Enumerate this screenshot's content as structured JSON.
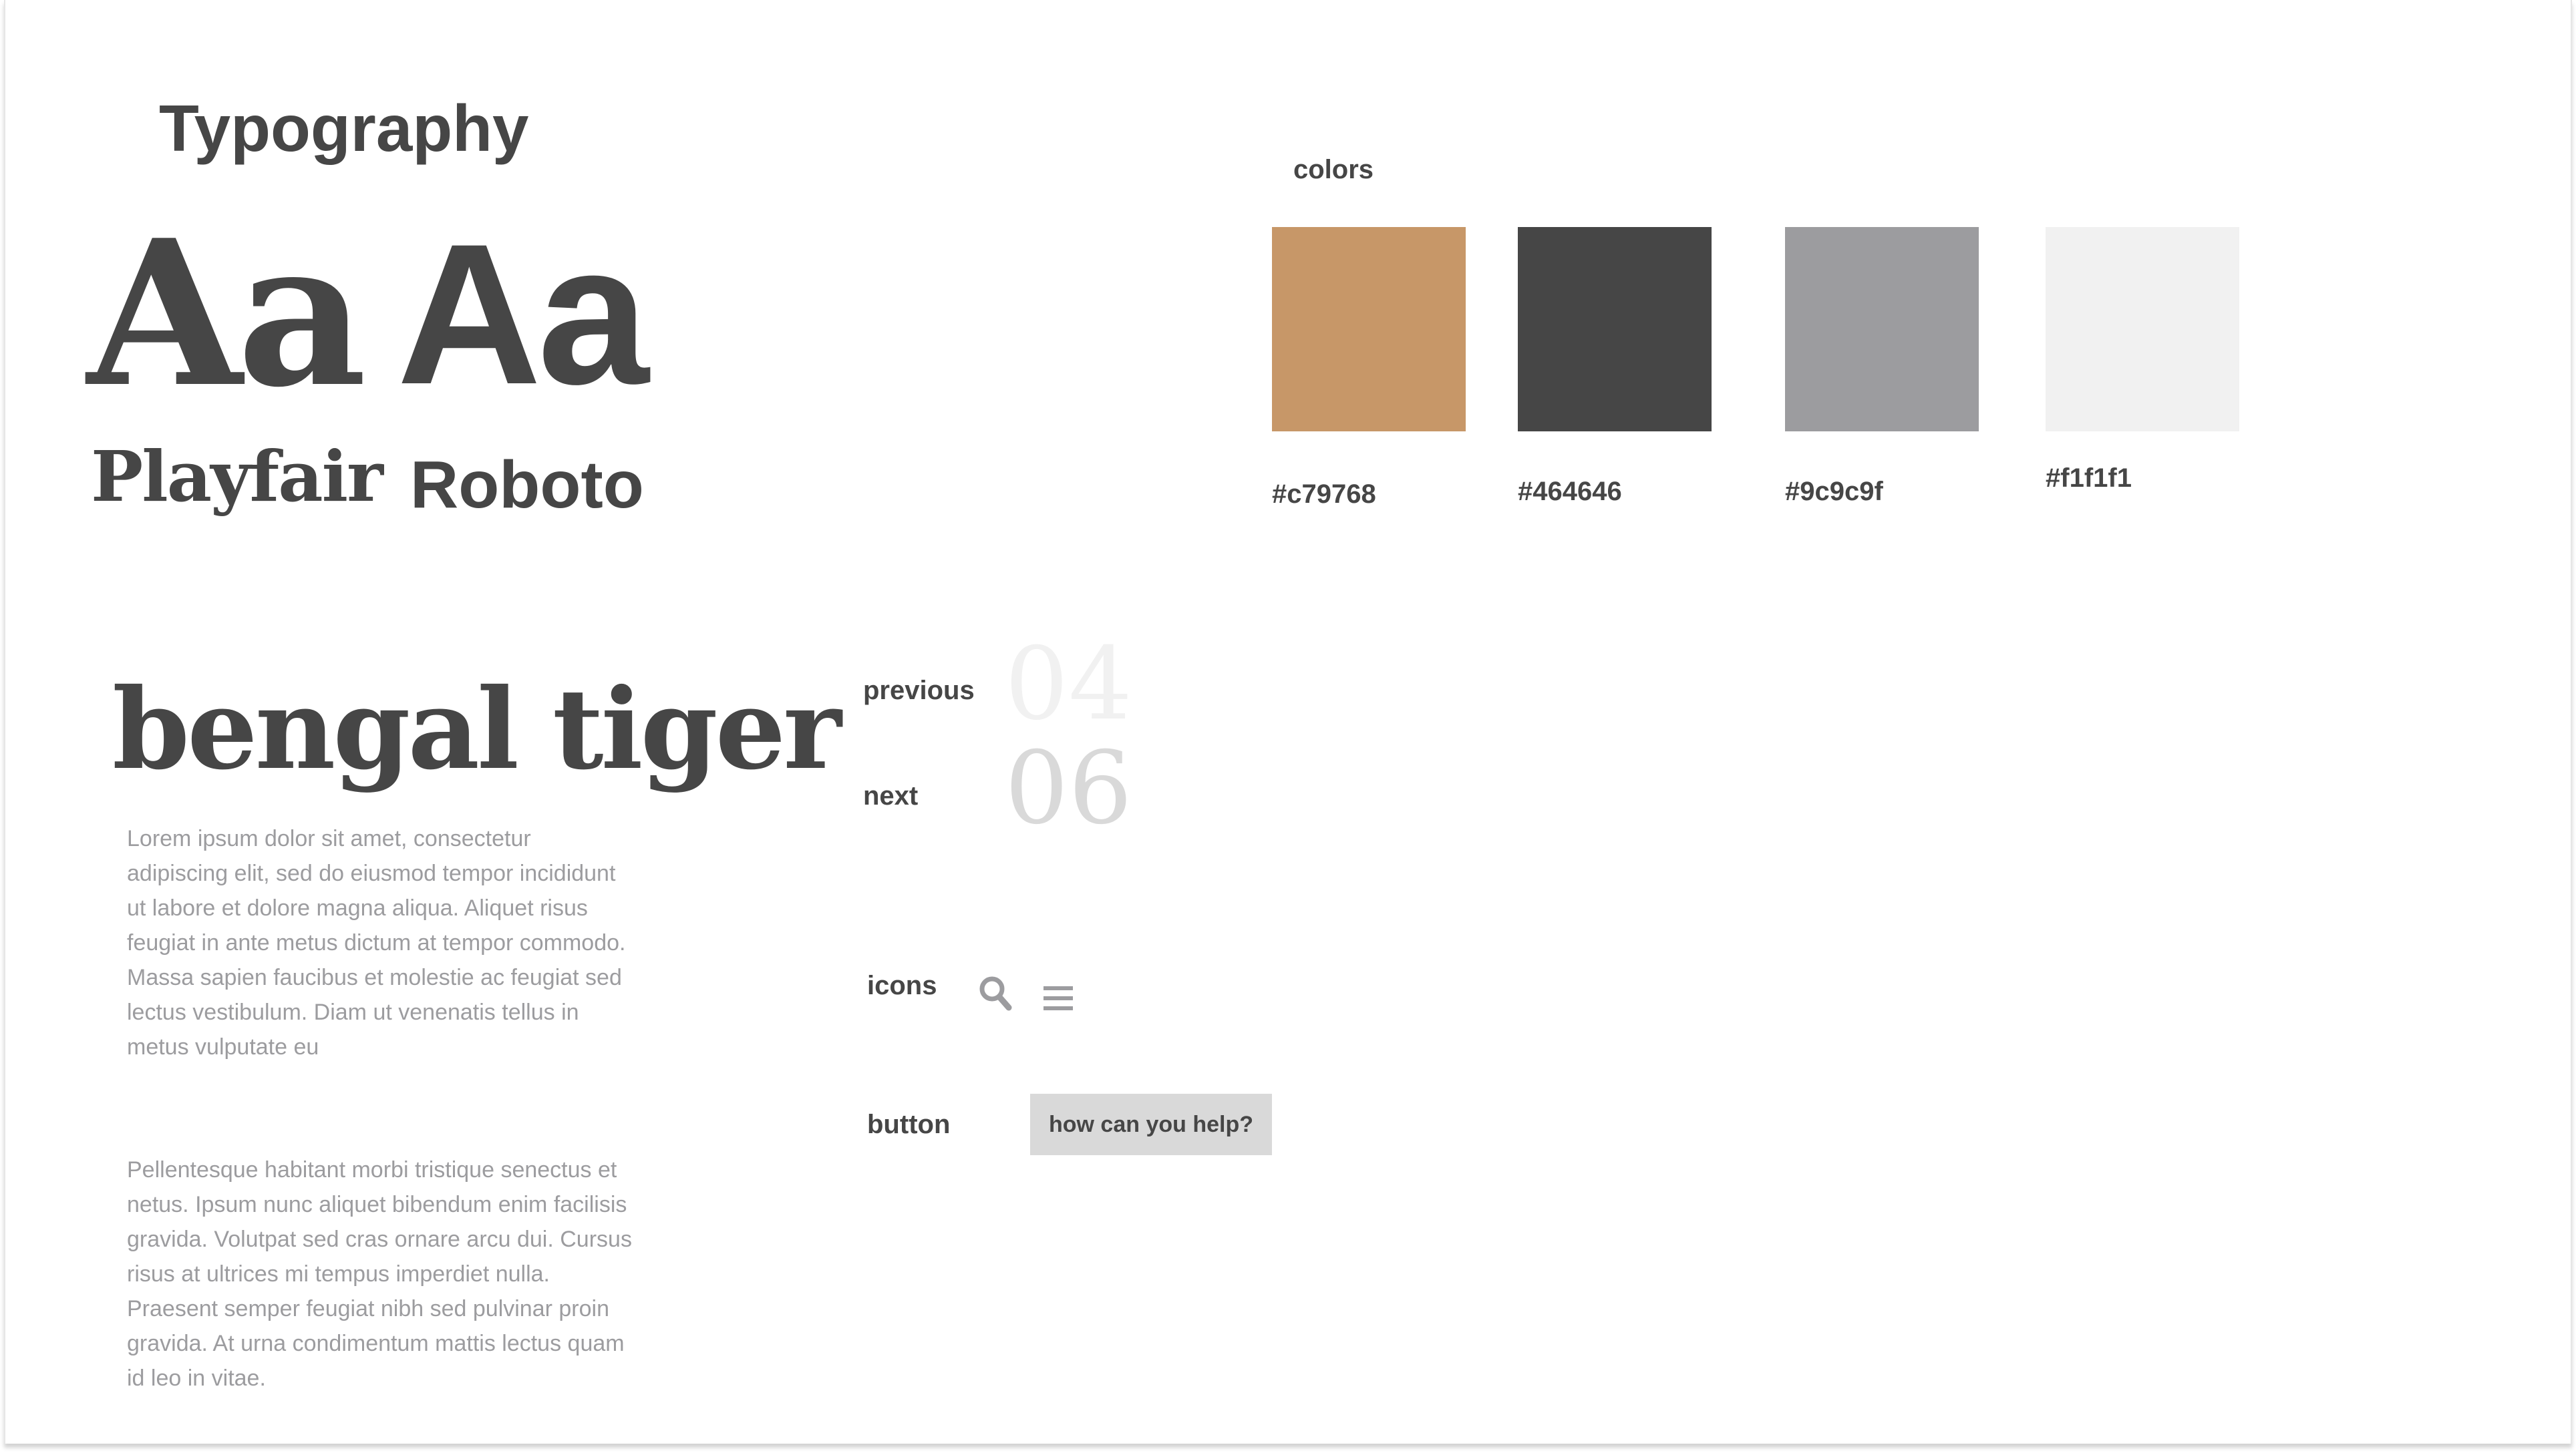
{
  "typography": {
    "heading": "Typography",
    "serif_sample": "Aa",
    "sans_sample": "Aa",
    "serif_name": "Playfair",
    "sans_name": "Roboto"
  },
  "colors": {
    "label": "colors",
    "swatches": [
      {
        "hex": "#c79768",
        "label": "#c79768"
      },
      {
        "hex": "#464646",
        "label": "#464646"
      },
      {
        "hex": "#9c9c9f",
        "label": "#9c9c9f"
      },
      {
        "hex": "#f1f1f1",
        "label": "#f1f1f1"
      }
    ]
  },
  "article": {
    "title": "bengal tiger",
    "paragraph1": "Lorem ipsum dolor sit amet, consectetur adipiscing elit, sed do eiusmod tempor incididunt ut labore et dolore magna aliqua. Aliquet risus feugiat in ante metus dictum at tempor commodo. Massa sapien faucibus et molestie ac feugiat sed lectus vestibulum. Diam ut venenatis tellus in metus vulputate eu",
    "paragraph2": "Pellentesque habitant morbi tristique senectus et netus. Ipsum nunc aliquet bibendum enim facilisis gravida. Volutpat sed cras ornare arcu dui. Cursus risus at ultrices mi tempus imperdiet nulla. Praesent semper feugiat nibh sed pulvinar proin gravida. At urna condimentum mattis lectus quam id leo in vitae."
  },
  "navigation": {
    "previous_label": "previous",
    "previous_number": "04",
    "next_label": "next",
    "next_number": "06"
  },
  "icons_section": {
    "label": "icons",
    "icons": [
      "search-icon",
      "menu-icon"
    ]
  },
  "button_section": {
    "label": "button",
    "button_text": "how can you help?"
  }
}
